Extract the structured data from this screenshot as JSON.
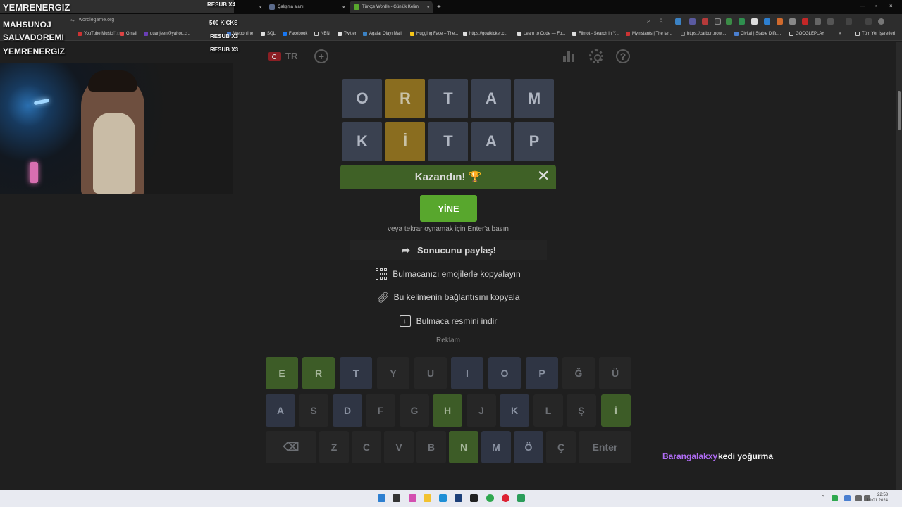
{
  "browser": {
    "tabs": [
      {
        "title": "",
        "active": false
      },
      {
        "title": "Çalışma alanı",
        "active": false
      },
      {
        "title": "Türkçe Wordle - Günlük Kelim",
        "active": true
      }
    ],
    "url": "wordlegame.org",
    "bookmarks": [
      "Webonline",
      "SQL",
      "Facebook",
      "NBN",
      "Twitter",
      "Agalar Olayı Mail",
      "Hugging Face – The...",
      "https://goalkicker.c...",
      "Learn to Code — Fo...",
      "Filmot - Search in Y...",
      "Myinstants | The lar...",
      "https://carbon.now....",
      "Civitai | Stable Diffu...",
      "GOOGLEPLAY",
      "Tüm Yer İşaretleri"
    ],
    "hidden_bookmarks": [
      "YouTube",
      "YouTube Music",
      "Gmail",
      "quanjeen@yahoo.c..."
    ]
  },
  "game": {
    "language": "TR",
    "rows": [
      [
        {
          "l": "O",
          "s": "absent"
        },
        {
          "l": "R",
          "s": "present"
        },
        {
          "l": "T",
          "s": "absent"
        },
        {
          "l": "A",
          "s": "absent"
        },
        {
          "l": "M",
          "s": "absent"
        }
      ],
      [
        {
          "l": "K",
          "s": "absent"
        },
        {
          "l": "İ",
          "s": "present"
        },
        {
          "l": "T",
          "s": "absent"
        },
        {
          "l": "A",
          "s": "absent"
        },
        {
          "l": "P",
          "s": "absent"
        }
      ]
    ]
  },
  "modal": {
    "title": "Kazandın! 🏆",
    "again_label": "YİNE",
    "hint": "veya tekrar oynamak için Enter'a basın",
    "share_label": "Sonucunu paylaş!",
    "copy_emoji_label": "Bulmacanızı emojilerle kopyalayın",
    "copy_link_label": "Bu kelimenin bağlantısını kopyala",
    "download_label": "Bulmaca resmini indir",
    "ad_label": "Reklam"
  },
  "keyboard": {
    "row1": [
      {
        "k": "E",
        "s": "correct"
      },
      {
        "k": "R",
        "s": "correct"
      },
      {
        "k": "T",
        "s": "absent"
      },
      {
        "k": "Y",
        "s": ""
      },
      {
        "k": "U",
        "s": ""
      },
      {
        "k": "I",
        "s": "absent"
      },
      {
        "k": "O",
        "s": "absent"
      },
      {
        "k": "P",
        "s": "absent"
      },
      {
        "k": "Ğ",
        "s": ""
      },
      {
        "k": "Ü",
        "s": ""
      }
    ],
    "row2": [
      {
        "k": "A",
        "s": "absent"
      },
      {
        "k": "S",
        "s": ""
      },
      {
        "k": "D",
        "s": "absent"
      },
      {
        "k": "F",
        "s": ""
      },
      {
        "k": "G",
        "s": ""
      },
      {
        "k": "H",
        "s": "correct"
      },
      {
        "k": "J",
        "s": ""
      },
      {
        "k": "K",
        "s": "absent"
      },
      {
        "k": "L",
        "s": ""
      },
      {
        "k": "Ş",
        "s": ""
      },
      {
        "k": "İ",
        "s": "correct"
      }
    ],
    "row3": [
      {
        "k": "⌫",
        "s": ""
      },
      {
        "k": "Z",
        "s": ""
      },
      {
        "k": "C",
        "s": ""
      },
      {
        "k": "V",
        "s": ""
      },
      {
        "k": "B",
        "s": ""
      },
      {
        "k": "N",
        "s": "correct"
      },
      {
        "k": "M",
        "s": "absent"
      },
      {
        "k": "Ö",
        "s": "absent"
      },
      {
        "k": "Ç",
        "s": ""
      },
      {
        "k": "Enter",
        "s": ""
      }
    ]
  },
  "stream": {
    "feed": [
      {
        "name": "YEMRENERGIZ",
        "tag": "RESUB X4"
      },
      {
        "name": "MAHSUNOJ",
        "tag": "500 KICKS"
      },
      {
        "name": "SALVADOREMI",
        "tag": "RESUB X3"
      },
      {
        "name": "YEMRENERGIZ",
        "tag": "RESUB X3"
      }
    ],
    "chat": {
      "user": "Barangalakxy",
      "message": "kedi yoğurma",
      "user_color": "#b06cf5"
    }
  },
  "taskbar": {
    "time": "22:53",
    "date": "19.01.2024"
  },
  "colors": {
    "correct": "#3d5c27",
    "present": "#8a6d1f",
    "absent": "#3a4150",
    "win_header": "#3f6126",
    "again_button": "#58a72d"
  }
}
